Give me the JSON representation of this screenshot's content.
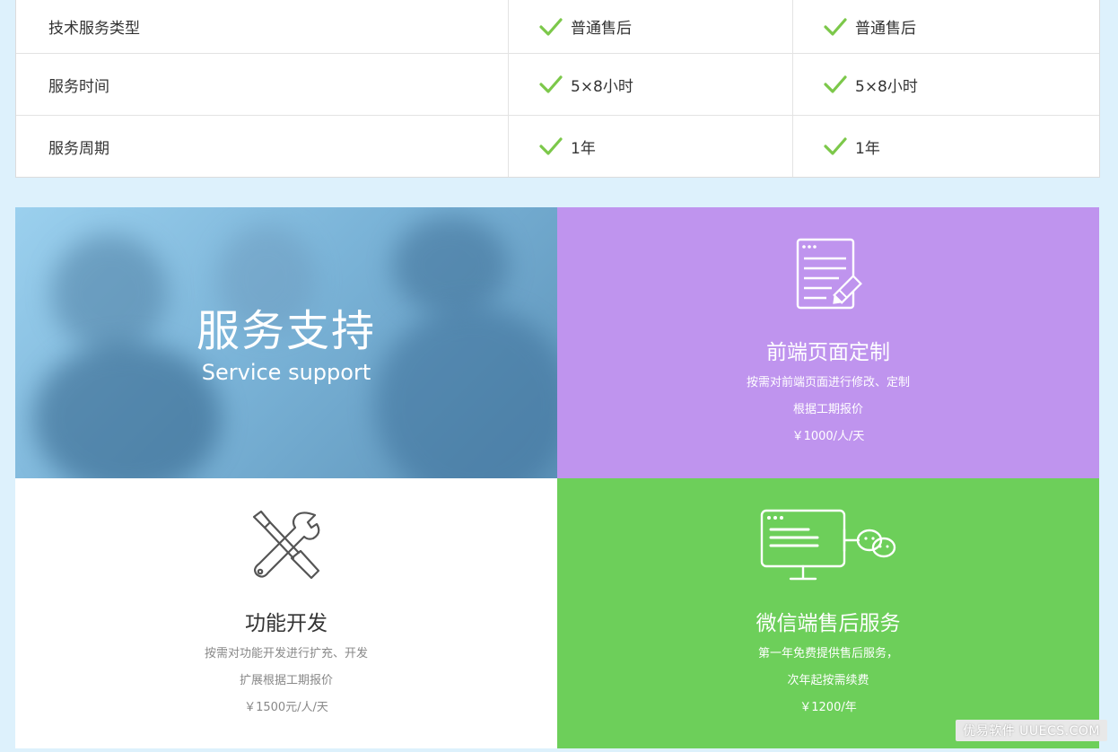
{
  "table": {
    "rows": [
      {
        "label": "技术服务类型",
        "col1": "普通售后",
        "col2": "普通售后"
      },
      {
        "label": "服务时间",
        "col1": "5×8小时",
        "col2": "5×8小时"
      },
      {
        "label": "服务周期",
        "col1": "1年",
        "col2": "1年"
      }
    ]
  },
  "hero": {
    "title": "服务支持",
    "subtitle": "Service support"
  },
  "frontend": {
    "title": "前端页面定制",
    "line1": "按需对前端页面进行修改、定制",
    "line2": "根据工期报价",
    "price": "￥1000/人/天"
  },
  "feature": {
    "title": "功能开发",
    "line1": "按需对功能开发进行扩充、开发",
    "line2": "扩展根据工期报价",
    "price": "￥1500元/人/天"
  },
  "wechat": {
    "title": "微信端售后服务",
    "line1": "第一年免费提供售后服务，",
    "line2": "次年起按需续费",
    "price": "￥1200/年"
  },
  "watermark": "优易软件 UUECS.COM",
  "colors": {
    "background": "#ddf1fc",
    "check": "#7cc84a",
    "purple": "#bf94ee",
    "green": "#6dcf5a"
  },
  "icons": [
    "check-icon",
    "document-edit-icon",
    "wrench-screwdriver-icon",
    "monitor-wechat-icon"
  ]
}
